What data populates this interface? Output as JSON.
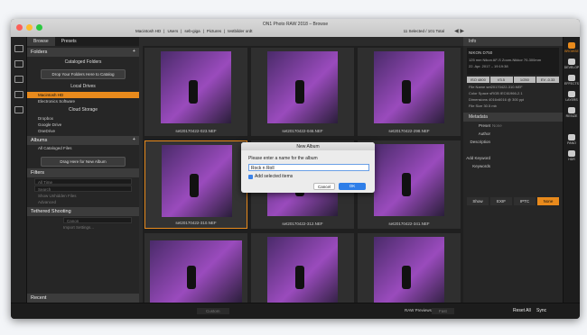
{
  "window_title": "ON1 Photo RAW 2018 – Browse",
  "breadcrumbs": [
    "Macintosh HD",
    "Users",
    "seb-giga",
    "Pictures",
    "testbilder ordt"
  ],
  "selection": "11 Selected / 101 Total",
  "left_tabs": [
    "Browse",
    "Presets"
  ],
  "folders": {
    "title": "Folders",
    "cataloged": "Cataloged Folders",
    "drop": "Drop Your Folders Here to Catalog",
    "local": "Local Drives",
    "drives": [
      "Macintosh HD",
      "Electronics Software"
    ],
    "cloud": "Cloud Storage",
    "cloud_items": [
      "Dropbox",
      "Google Drive",
      "OneDrive"
    ]
  },
  "albums": {
    "title": "Albums",
    "item": "All Cataloged Files",
    "drag": "Drag Here for New Album"
  },
  "filters": {
    "title": "Filters",
    "all_time": "All Time",
    "search": "Search",
    "show_hidden": "Show Unhidden Files",
    "advanced": "Advanced"
  },
  "tethered": {
    "title": "Tethered Shooting",
    "camera": "Canon",
    "import": "Import Settings..."
  },
  "recent": "Recent",
  "thumbs": [
    "set20170422-023.NEF",
    "set20170422-046.NEF",
    "set20170422-298.NEF",
    "set20170422-310.NEF",
    "set20170422-312.NEF",
    "set20170422-341.NEF",
    "",
    "",
    ""
  ],
  "info_tab": "Info",
  "camera": "NIKON D750",
  "lens": "125 mm Nikon AF-S Zoom-Nikkor 70-300mm",
  "date": "22. Apr. 2017 – 19:19:38",
  "exif": [
    "ISO 4800",
    "f/3.5",
    "1/250",
    "EV -0.33"
  ],
  "meta_kv": [
    "File Name  set20170422-310.NEF",
    "Color Space  sRGB IEC61966-2.1",
    "Dimensions  4016x6016 @ 300 ppi",
    "File Size  30.5 mb"
  ],
  "metadata": {
    "title": "Metadata",
    "preset_label": "Preset",
    "preset_value": "None",
    "fields": [
      "Author",
      "Description",
      "",
      "Add Keyword",
      "Keywords"
    ],
    "tabs": [
      "Show",
      "EXIF",
      "IPTC",
      "None"
    ]
  },
  "modules": [
    "BROWSE",
    "DEVELOP",
    "EFFECTS",
    "LAYERS",
    "RESIZE",
    "",
    "PANO",
    "HDR"
  ],
  "bottom": {
    "custom": "Custom",
    "raw": "RAW Previews",
    "fast": "Fast",
    "reset": "Reset All",
    "sync": "Sync"
  },
  "dialog": {
    "title": "New Album",
    "prompt": "Please enter a name for the album",
    "value": "Rock n Roll",
    "checkbox": "Add selected items",
    "cancel": "Cancel",
    "ok": "OK"
  }
}
